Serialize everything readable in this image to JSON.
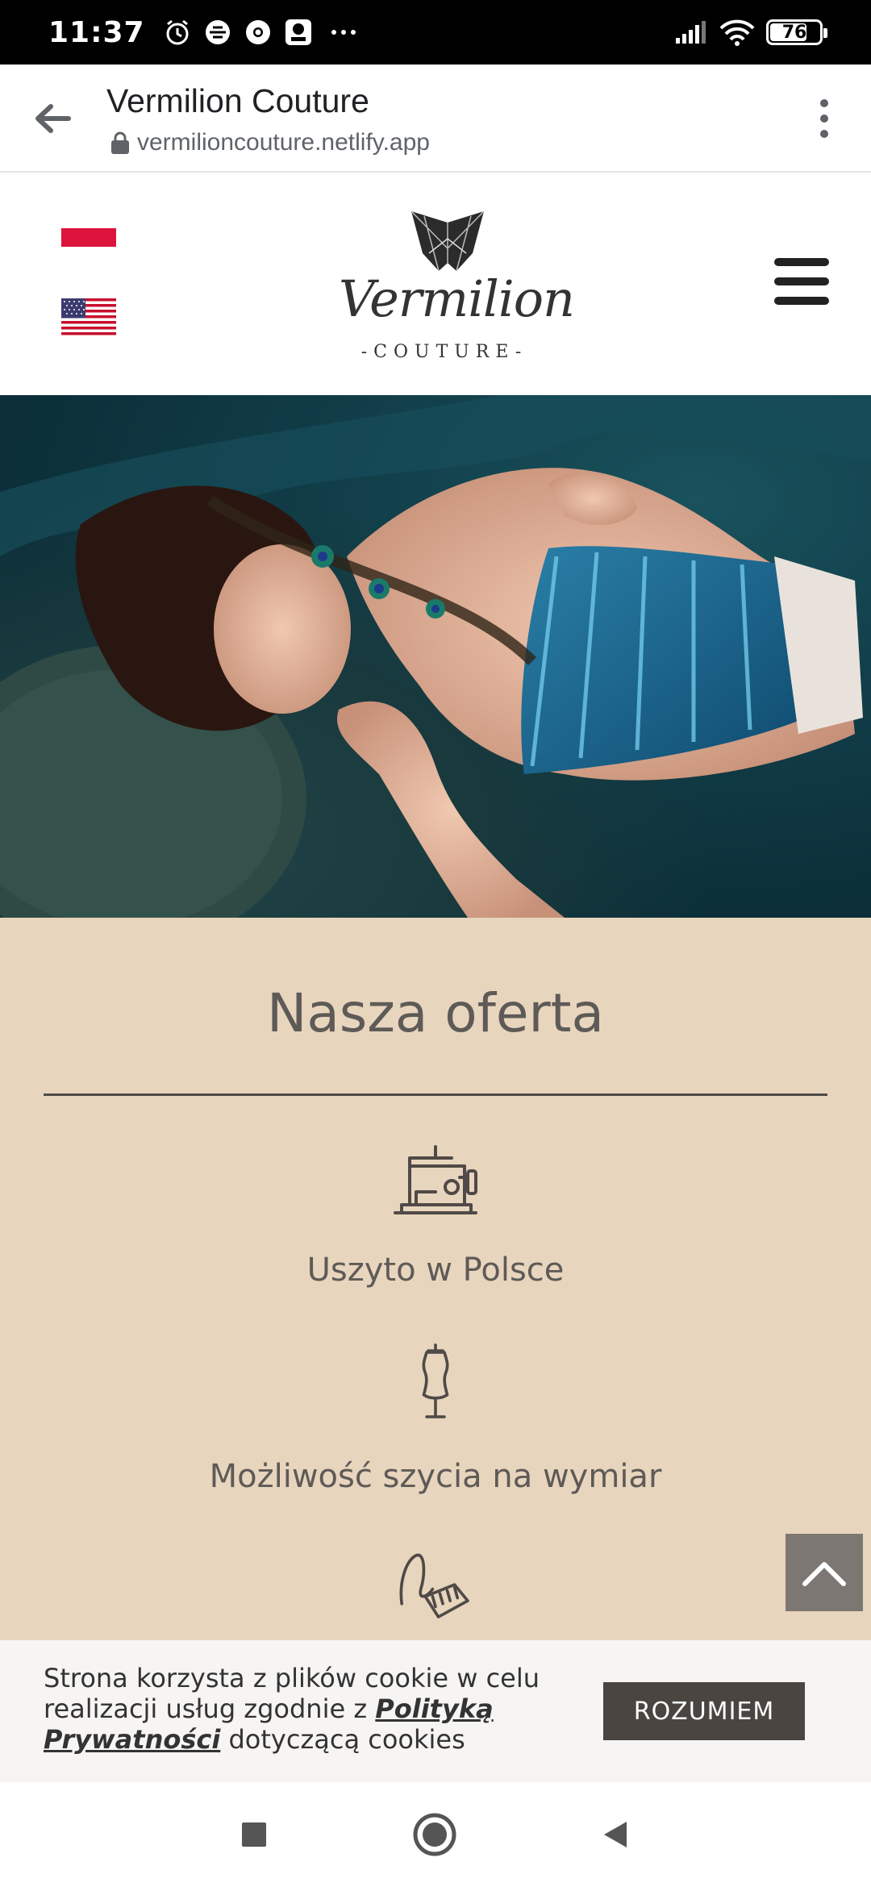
{
  "status_bar": {
    "time": "11:37",
    "battery": "76",
    "battery_level": 0.76,
    "icons": [
      "alarm-icon",
      "app-icon",
      "chrome-icon",
      "lidl-plus-icon",
      "more-icon",
      "signal-icon",
      "wifi-icon",
      "battery-icon"
    ]
  },
  "browser": {
    "title": "Vermilion Couture",
    "url": "vermilioncouture.netlify.app"
  },
  "header": {
    "logo_text": "Vermilion",
    "logo_sub": "-COUTURE-"
  },
  "offer": {
    "title": "Nasza oferta",
    "items": [
      {
        "icon": "sewing-machine-icon",
        "label": "Uszyto w Polsce"
      },
      {
        "icon": "mannequin-icon",
        "label": "Możliwość szycia na wymiar"
      },
      {
        "icon": "measuring-tape-icon",
        "label": ""
      }
    ]
  },
  "cookie": {
    "text_before": "Strona korzysta z plików cookie w celu realizacji usług zgodnie z ",
    "link": "Polityką Prywatności",
    "text_after": " dotyczącą cookies",
    "button": "ROZUMIEM"
  },
  "colors": {
    "content_bg": "#e8d5bd",
    "text": "#5e5a57",
    "button_bg": "#4a4541"
  }
}
